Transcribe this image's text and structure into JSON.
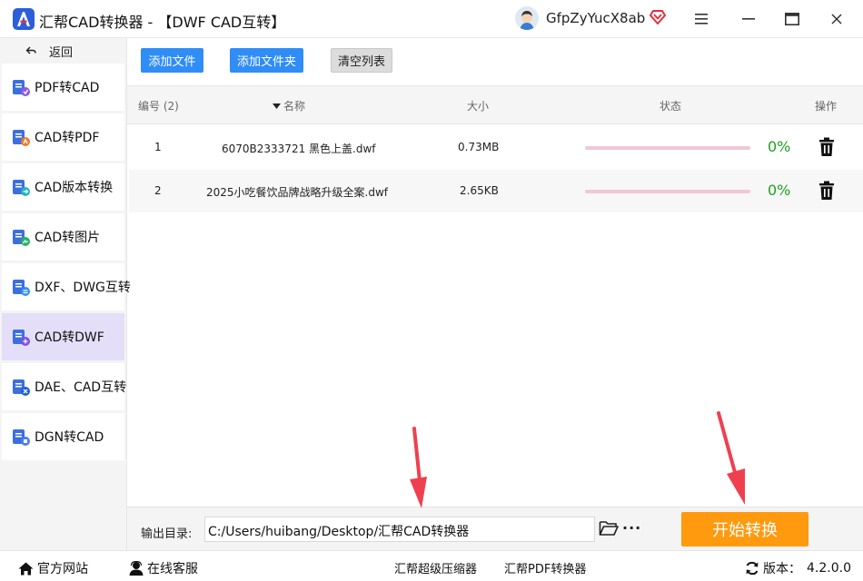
{
  "titlebar": {
    "title": "汇帮CAD转换器 - 【DWF CAD互转】",
    "username": "GfpZyYucX8ab"
  },
  "sidebar": {
    "back_label": "返回",
    "items": [
      {
        "label": "PDF转CAD",
        "icon": "pdf-to-cad-icon"
      },
      {
        "label": "CAD转PDF",
        "icon": "cad-to-pdf-icon"
      },
      {
        "label": "CAD版本转换",
        "icon": "cad-version-icon"
      },
      {
        "label": "CAD转图片",
        "icon": "cad-to-image-icon"
      },
      {
        "label": "DXF、DWG互转",
        "icon": "dxf-dwg-icon"
      },
      {
        "label": "CAD转DWF",
        "icon": "cad-to-dwf-icon",
        "active": true
      },
      {
        "label": "DAE、CAD互转",
        "icon": "dae-cad-icon"
      },
      {
        "label": "DGN转CAD",
        "icon": "dgn-to-cad-icon"
      }
    ]
  },
  "toolbar": {
    "add_file": "添加文件",
    "add_folder": "添加文件夹",
    "clear_list": "清空列表"
  },
  "table": {
    "headers": {
      "index": "编号 (2)",
      "name": "名称",
      "size": "大小",
      "status": "状态",
      "action": "操作"
    },
    "rows": [
      {
        "index": "1",
        "name": "6070B2333721 黑色上盖.dwf",
        "size": "0.73MB",
        "progress": "0%"
      },
      {
        "index": "2",
        "name": "2025小吃餐饮品牌战略升级全案.dwf",
        "size": "2.65KB",
        "progress": "0%"
      }
    ]
  },
  "output": {
    "label": "输出目录:",
    "path": "C:/Users/huibang/Desktop/汇帮CAD转换器",
    "more": "···",
    "start": "开始转换"
  },
  "footer": {
    "website": "官方网站",
    "support": "在线客服",
    "compress": "汇帮超级压缩器",
    "pdf_converter": "汇帮PDF转换器",
    "version_label": "版本：",
    "version": "4.2.0.0"
  },
  "colors": {
    "accent_blue": "#2f8df5",
    "start_orange": "#ff9a0e",
    "active_nav": "#e5def8",
    "progress_track": "#f1c7d3",
    "percent_green": "#1ea01e",
    "annotation_red": "#ef4050"
  }
}
